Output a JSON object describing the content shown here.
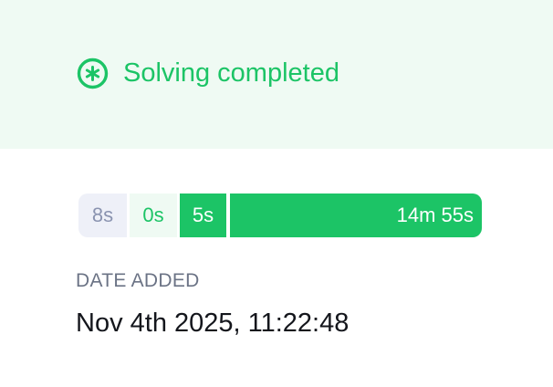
{
  "status": {
    "icon": "asterisk-circle-icon",
    "text": "Solving completed",
    "color": "#1cc466",
    "background": "#effaf3"
  },
  "timeline": {
    "segments": [
      {
        "label": "8s"
      },
      {
        "label": "0s"
      },
      {
        "label": "5s"
      },
      {
        "label": "14m 55s"
      }
    ]
  },
  "date": {
    "label": "DATE ADDED",
    "value": "Nov 4th 2025, 11:22:48"
  }
}
